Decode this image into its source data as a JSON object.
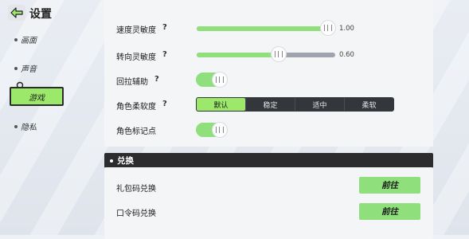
{
  "header": {
    "title": "设置"
  },
  "sidebar": {
    "items": [
      {
        "label": "画面"
      },
      {
        "label": "声音"
      },
      {
        "label": "游戏"
      },
      {
        "label": "隐私"
      }
    ]
  },
  "settings": {
    "speed_sensitivity": {
      "label": "速度灵敏度",
      "value_text": "1.00",
      "fraction": 1.0
    },
    "turn_sensitivity": {
      "label": "转向灵敏度",
      "value_text": "0.60",
      "fraction": 0.6
    },
    "pullback_assist": {
      "label": "回拉辅助",
      "on": true
    },
    "character_softness": {
      "label": "角色柔软度",
      "options": [
        "默认",
        "稳定",
        "适中",
        "柔软"
      ],
      "selected": "默认"
    },
    "character_marker": {
      "label": "角色标记点",
      "on": true
    }
  },
  "redeem": {
    "section_title": "兑换",
    "gift_code": {
      "label": "礼包码兑换",
      "button": "前往"
    },
    "password_code": {
      "label": "口令码兑换",
      "button": "前往"
    }
  },
  "colors": {
    "accent": "#8fe07c",
    "dark": "#2c2c2e"
  }
}
